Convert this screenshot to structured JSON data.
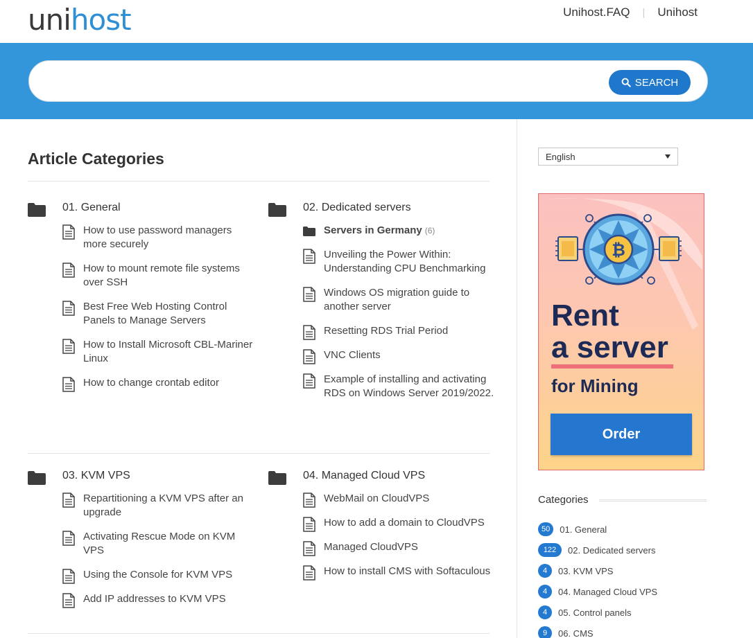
{
  "header": {
    "logo_part1": "uni",
    "logo_part2": "host",
    "links": [
      "Unihost.FAQ",
      "Unihost"
    ],
    "separator": "|"
  },
  "search": {
    "placeholder": "",
    "button_label": "SEARCH"
  },
  "main": {
    "title": "Article Categories",
    "categories": [
      {
        "title": "01. General",
        "subcategory": null,
        "items": [
          "How to use password managers more securely",
          "How to mount remote file systems over SSH",
          "Best Free Web Hosting Control Panels to Manage Servers",
          "How to Install Microsoft CBL-Mariner Linux",
          "How to change crontab editor"
        ]
      },
      {
        "title": "02. Dedicated servers",
        "subcategory": {
          "label": "Servers in Germany",
          "count": "(6)"
        },
        "items": [
          "Unveiling the Power Within: Understanding CPU Benchmarking",
          "Windows OS migration guide to another server",
          "Resetting RDS Trial Period",
          "VNC Clients",
          "Example of installing and activating RDS on Windows Server 2019/2022."
        ]
      },
      {
        "title": "03. KVM VPS",
        "subcategory": null,
        "items": [
          "Repartitioning a KVM VPS after an upgrade",
          "Activating Rescue Mode on KVM VPS",
          "Using the Console for KVM VPS",
          "Add IP addresses to KVM VPS"
        ]
      },
      {
        "title": "04. Managed Cloud VPS",
        "subcategory": null,
        "items": [
          "WebMail on CloudVPS",
          "How to add a domain to CloudVPS",
          "Managed CloudVPS",
          "How to install CMS with Softaculous"
        ]
      }
    ]
  },
  "sidebar": {
    "language": "English",
    "ad": {
      "line1": "Rent",
      "line2": "a server",
      "line3": "for Mining",
      "button": "Order"
    },
    "categories_title": "Categories",
    "categories": [
      {
        "count": "50",
        "label": "01. General"
      },
      {
        "count": "122",
        "label": "02. Dedicated servers"
      },
      {
        "count": "4",
        "label": "03. KVM VPS"
      },
      {
        "count": "4",
        "label": "04. Managed Cloud VPS"
      },
      {
        "count": "4",
        "label": "05. Control panels"
      },
      {
        "count": "9",
        "label": "06. CMS"
      }
    ]
  },
  "colors": {
    "brand_blue": "#3396db",
    "button_blue": "#1f78cc",
    "text": "#333333"
  }
}
